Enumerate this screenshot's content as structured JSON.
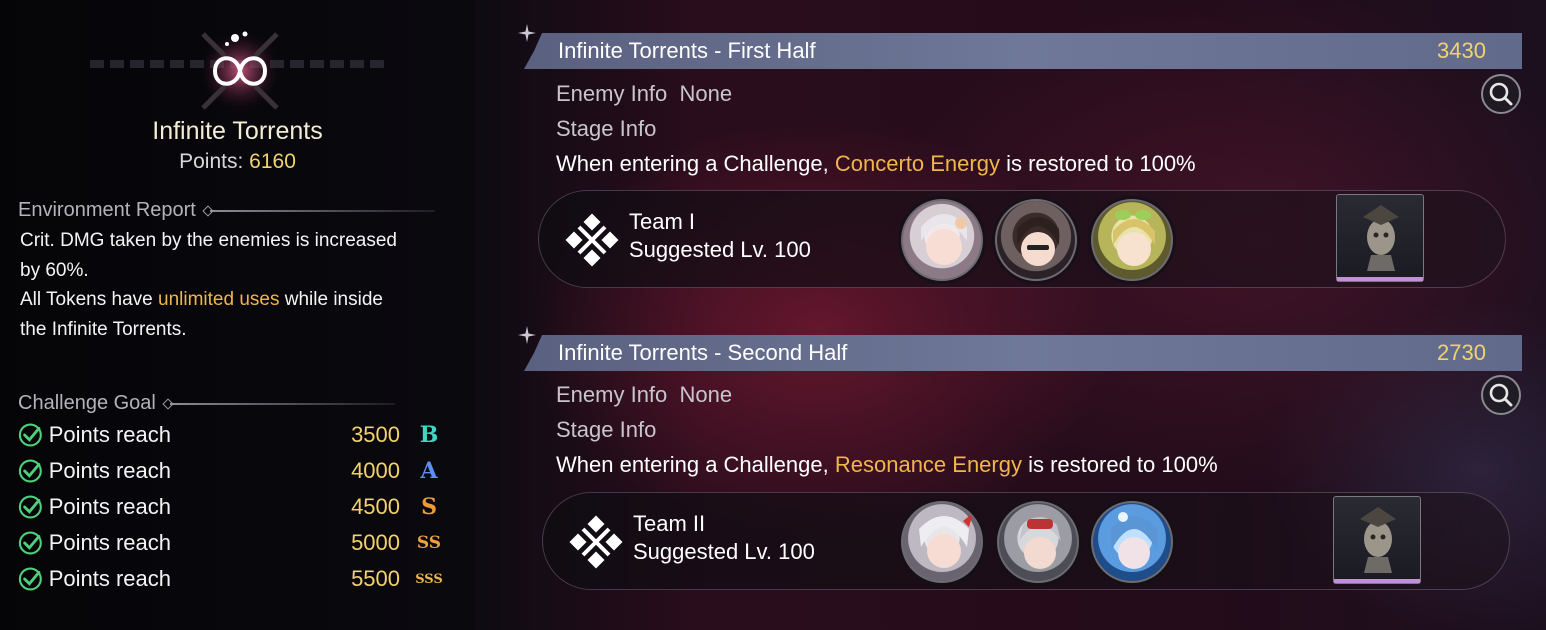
{
  "left": {
    "title": "Infinite Torrents",
    "points_label": "Points:",
    "points_value": "6160",
    "environment_report": {
      "heading": "Environment Report",
      "line1": "Crit. DMG taken by the enemies is increased",
      "line2": "by 60%.",
      "line3_pre": "All Tokens have ",
      "line3_hl": "unlimited uses",
      "line3_post": " while inside",
      "line4": "the Infinite Torrents."
    },
    "challenge_goal": {
      "heading": "Challenge Goal",
      "goals": [
        {
          "label": "Points reach",
          "value": "3500",
          "rank": "B",
          "rank_color": "#3fd6c2"
        },
        {
          "label": "Points reach",
          "value": "4000",
          "rank": "A",
          "rank_color": "#5b8ff0"
        },
        {
          "label": "Points reach",
          "value": "4500",
          "rank": "S",
          "rank_color": "#f09a36"
        },
        {
          "label": "Points reach",
          "value": "5000",
          "rank": "SS",
          "rank_color": "#f0a040"
        },
        {
          "label": "Points reach",
          "value": "5500",
          "rank": "SSS",
          "rank_color": "#f2b648"
        }
      ]
    }
  },
  "stages": [
    {
      "title": "Infinite Torrents - First Half",
      "score": "3430",
      "enemy_info_label": "Enemy Info",
      "enemy_info_value": "None",
      "stage_info_label": "Stage Info",
      "desc_pre": "When entering a Challenge, ",
      "desc_hl": "Concerto Energy",
      "desc_post": " is restored to 100%",
      "team_name": "Team I",
      "suggested": "Suggested Lv. 100"
    },
    {
      "title": "Infinite Torrents - Second Half",
      "score": "2730",
      "enemy_info_label": "Enemy Info",
      "enemy_info_value": "None",
      "stage_info_label": "Stage Info",
      "desc_pre": "When entering a Challenge, ",
      "desc_hl": "Resonance Energy",
      "desc_post": " is restored to 100%",
      "team_name": "Team II",
      "suggested": "Suggested Lv. 100"
    }
  ],
  "colors": {
    "accent_gold": "#f2d36b",
    "highlight_orange": "#f0b64a",
    "header_bar": "#6f7898",
    "check_green": "#4fd07a"
  },
  "icons": [
    "infinite-torrents-emblem-icon",
    "check-icon",
    "magnifier-icon",
    "team-cross-icon",
    "character-avatar-icon",
    "echo-bust-icon"
  ]
}
